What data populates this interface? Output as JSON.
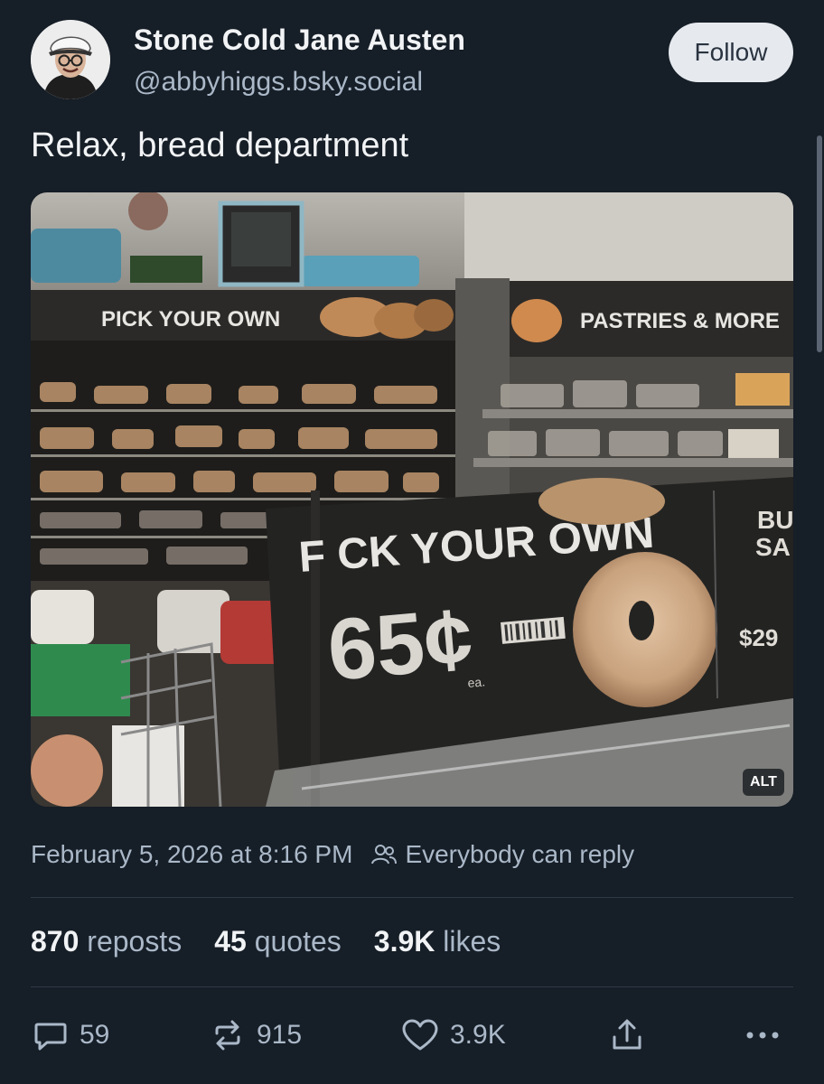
{
  "author": {
    "name": "Stone Cold Jane Austen",
    "handle": "@abbyhiggs.bsky.social"
  },
  "follow_label": "Follow",
  "post_text": "Relax, bread department",
  "media": {
    "alt_badge": "ALT",
    "sign_left_top": "PICK YOUR OWN",
    "sign_right_top": "PASTRIES & MORE",
    "sign_main": "F CK YOUR OWN",
    "sign_price": "65¢",
    "sign_price_unit": "ea.",
    "sign_edge_line1": "BU",
    "sign_edge_line2": "SA",
    "sign_edge_price": "$29"
  },
  "meta": {
    "timestamp": "February 5, 2026 at 8:16 PM",
    "reply_setting": "Everybody can reply"
  },
  "stats": {
    "reposts_count": "870",
    "reposts_label": "reposts",
    "quotes_count": "45",
    "quotes_label": "quotes",
    "likes_count": "3.9K",
    "likes_label": "likes"
  },
  "actions": {
    "reply_count": "59",
    "repost_count": "915",
    "like_count": "3.9K"
  },
  "icons": {
    "reply": "speech-bubble-icon",
    "repost": "repost-arrows-icon",
    "like": "heart-icon",
    "share": "share-icon",
    "more": "ellipsis-icon",
    "reply_setting": "people-icon"
  },
  "colors": {
    "background": "#161e27",
    "text_primary": "#f1f3f5",
    "text_secondary": "#aab8c8",
    "follow_button_bg": "#e6eaef"
  }
}
